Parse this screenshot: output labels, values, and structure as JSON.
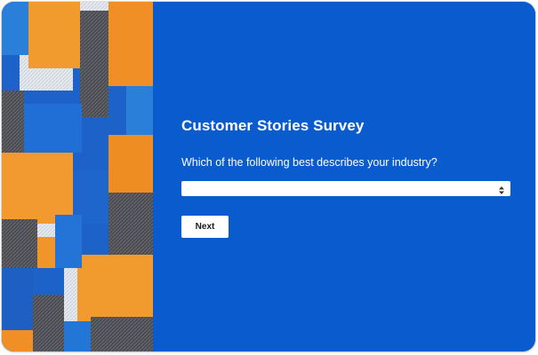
{
  "survey": {
    "title": "Customer Stories Survey",
    "question": "Which of the following best describes your industry?",
    "industry_select": {
      "selected_value": ""
    },
    "next_label": "Next"
  },
  "colors": {
    "panel_background": "#0a5cce",
    "button_background": "#ffffff",
    "text": "#ffffff",
    "art_palette": [
      "#1b5fc4",
      "#f0922b",
      "#4d4d52",
      "#e9edf3",
      "#2a7fd8"
    ]
  },
  "icons": {
    "select_arrows": "up-down-chevron-icon"
  }
}
